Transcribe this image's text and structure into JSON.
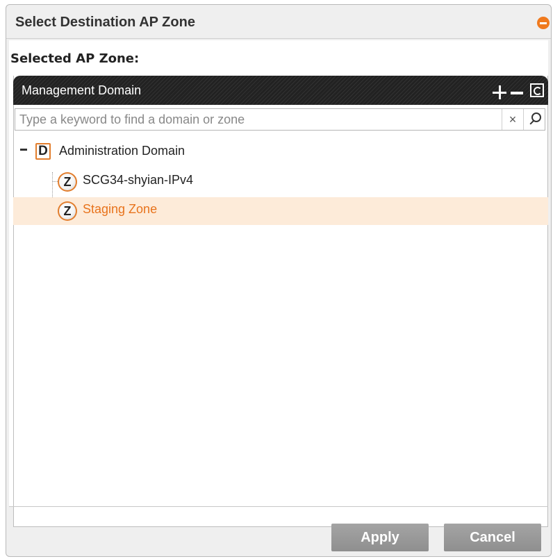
{
  "dialog": {
    "title": "Select Destination AP Zone",
    "close_icon": "close-icon"
  },
  "selected_zone_label": "Selected AP Zone:",
  "panel": {
    "title": "Management Domain",
    "add_icon": "add-icon",
    "remove_icon": "remove-icon",
    "refresh_icon": "refresh-icon"
  },
  "search": {
    "placeholder": "Type a keyword to find a domain or zone",
    "value": "",
    "clear_symbol": "×"
  },
  "tree": {
    "domain": {
      "badge": "D",
      "label": "Administration Domain",
      "expanded": true
    },
    "zones": [
      {
        "badge": "Z",
        "label": "SCG34-shyian-IPv4",
        "selected": false
      },
      {
        "badge": "Z",
        "label": "Staging Zone",
        "selected": true
      }
    ]
  },
  "buttons": {
    "apply": "Apply",
    "cancel": "Cancel"
  },
  "colors": {
    "accent_orange": "#e8731c",
    "selected_row_bg": "#fdebd9",
    "header_dark": "#222222",
    "button_gray": "#999999"
  }
}
